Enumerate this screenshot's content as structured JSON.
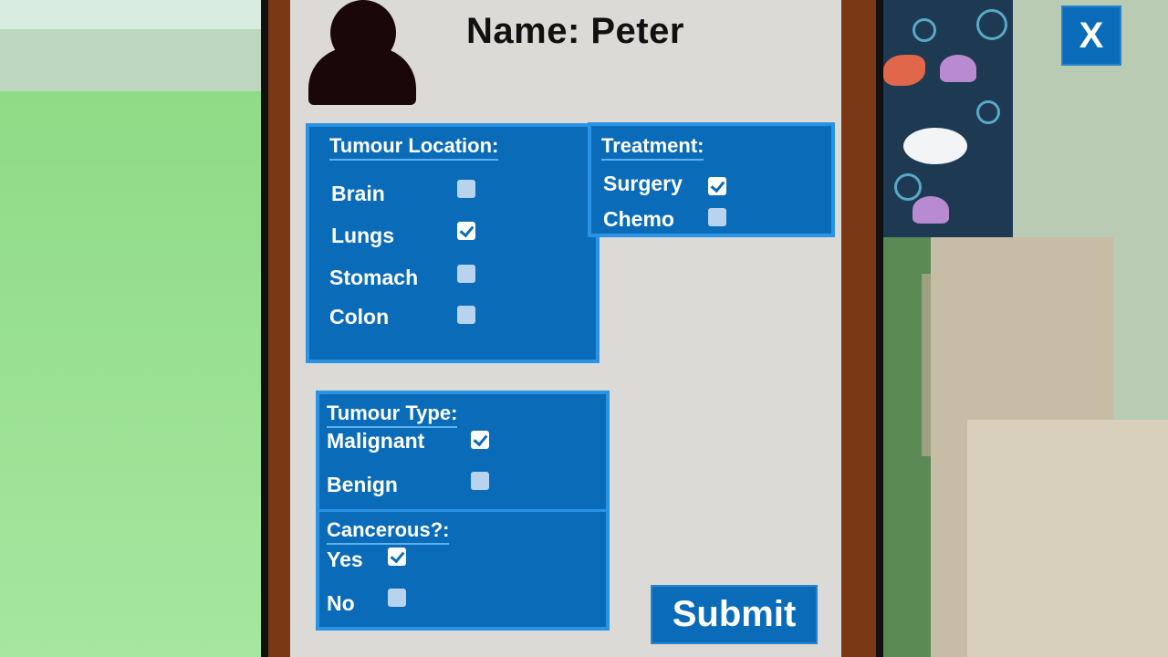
{
  "profile": {
    "name_line": "Name: Peter"
  },
  "tumour_location": {
    "title": "Tumour Location:",
    "options": [
      {
        "label": "Brain",
        "checked": false
      },
      {
        "label": "Lungs",
        "checked": true
      },
      {
        "label": "Stomach",
        "checked": false
      },
      {
        "label": "Colon",
        "checked": false
      }
    ]
  },
  "treatment": {
    "title": "Treatment:",
    "options": [
      {
        "label": "Surgery",
        "checked": true
      },
      {
        "label": "Chemo",
        "checked": false
      }
    ]
  },
  "tumour_type": {
    "title": "Tumour Type:",
    "options": [
      {
        "label": "Malignant",
        "checked": true
      },
      {
        "label": "Benign",
        "checked": false
      }
    ]
  },
  "cancerous": {
    "title": "Cancerous?:",
    "options": [
      {
        "label": "Yes",
        "checked": true
      },
      {
        "label": "No",
        "checked": false
      }
    ]
  },
  "actions": {
    "submit_label": "Submit",
    "close_label": "X"
  },
  "colors": {
    "panel_blue": "#0a6cb8",
    "panel_border": "#2b93e4",
    "board_brown": "#7a3814",
    "paper": "#dcdad6"
  },
  "icons": {
    "avatar": "person-silhouette-icon",
    "check": "checkmark-icon"
  }
}
